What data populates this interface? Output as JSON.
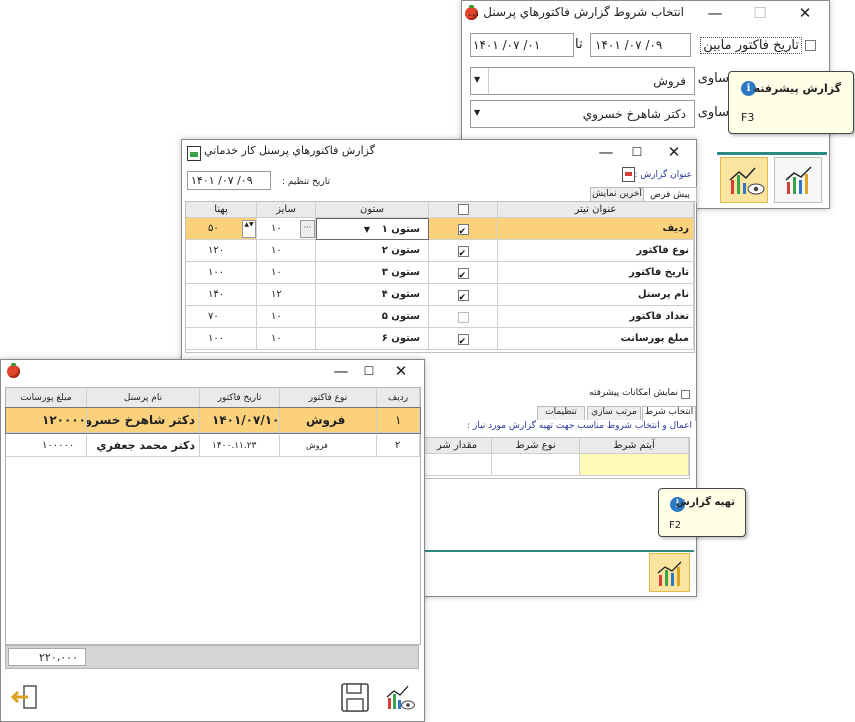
{
  "win1": {
    "title": "انتخاب شروط گزارش فاكتورهاي پرسنل ...",
    "date_label": "تاريخ فاكتور مابين",
    "date_from": "۱۴۰۱ /۰۷ /۰۱",
    "date_to_label": "تا",
    "date_to": "۱۴۰۱ /۰۷ /۰۹",
    "row2_label": "ساوی",
    "row2_value": "فروش",
    "row3_label": "ساوی",
    "row3_value": "دكتر شاهرخ خسروي",
    "tooltip_title": "گزارش پيشرفته",
    "tooltip_key": "F3"
  },
  "win2": {
    "title": "گزارش فاكتورهاي پرسنل كار خدماتي",
    "report_title_label": "عنوان گزارش :",
    "date_label": "تاريخ تنظيم :",
    "date_value": "۱۴۰۱ /۰۷ /۰۹",
    "tabs": [
      "پيش فرض",
      "آخرين نمايش"
    ],
    "headers": {
      "title": "عنوان تيتر",
      "check": "",
      "column": "ستون",
      "size": "سايز",
      "width": "پهنا"
    },
    "rows": [
      {
        "title": "رديف",
        "checked": true,
        "column": "ستون ۱",
        "size": "۱۰",
        "width": "۵۰"
      },
      {
        "title": "نوع فاكتور",
        "checked": true,
        "column": "ستون ۲",
        "size": "۱۰",
        "width": "۱۲۰"
      },
      {
        "title": "تاريخ فاكتور",
        "checked": true,
        "column": "ستون ۳",
        "size": "۱۰",
        "width": "۱۰۰"
      },
      {
        "title": "نام پرسنل",
        "checked": true,
        "column": "ستون ۴",
        "size": "۱۲",
        "width": "۱۴۰"
      },
      {
        "title": "تعداد فاكتور",
        "checked": false,
        "column": "ستون ۵",
        "size": "۱۰",
        "width": "۷۰"
      },
      {
        "title": "مبلغ پورسانت",
        "checked": true,
        "column": "ستون ۶",
        "size": "۱۰",
        "width": "۱۰۰"
      }
    ],
    "advanced_label": "نمايش امكانات پيشرفته",
    "bottom_tabs": [
      "انتخاب شرط",
      "مرتب سازي",
      "تنظيمات"
    ],
    "hint": "اعمال و انتخاب شروط مناسب جهت تهيه گزارش  مورد نياز :",
    "cond_headers": [
      "آيتم شرط",
      "نوع شرط",
      "مقدار شر"
    ],
    "tooltip_title": "تهيه گزارش",
    "tooltip_key": "F2"
  },
  "win3": {
    "headers": {
      "row": "رديف",
      "type": "نوع فاكتور",
      "date": "تاريخ فاكتور",
      "name": "نام پرسنل",
      "amount": "مبلغ پورسانت"
    },
    "rows": [
      {
        "row": "۱",
        "type": "فروش",
        "date": "۱۴۰۱/۰۷/۱۰",
        "name": "دكتر شاهرخ خسروي",
        "amount": "۱۲۰۰۰۰"
      },
      {
        "row": "۲",
        "type": "فروش",
        "date": "۱۴۰۰.۱۱.۲۳",
        "name": "دكتر محمد جعفري",
        "amount": "۱۰۰۰۰۰"
      }
    ],
    "total": "۲۲۰،۰۰۰"
  }
}
